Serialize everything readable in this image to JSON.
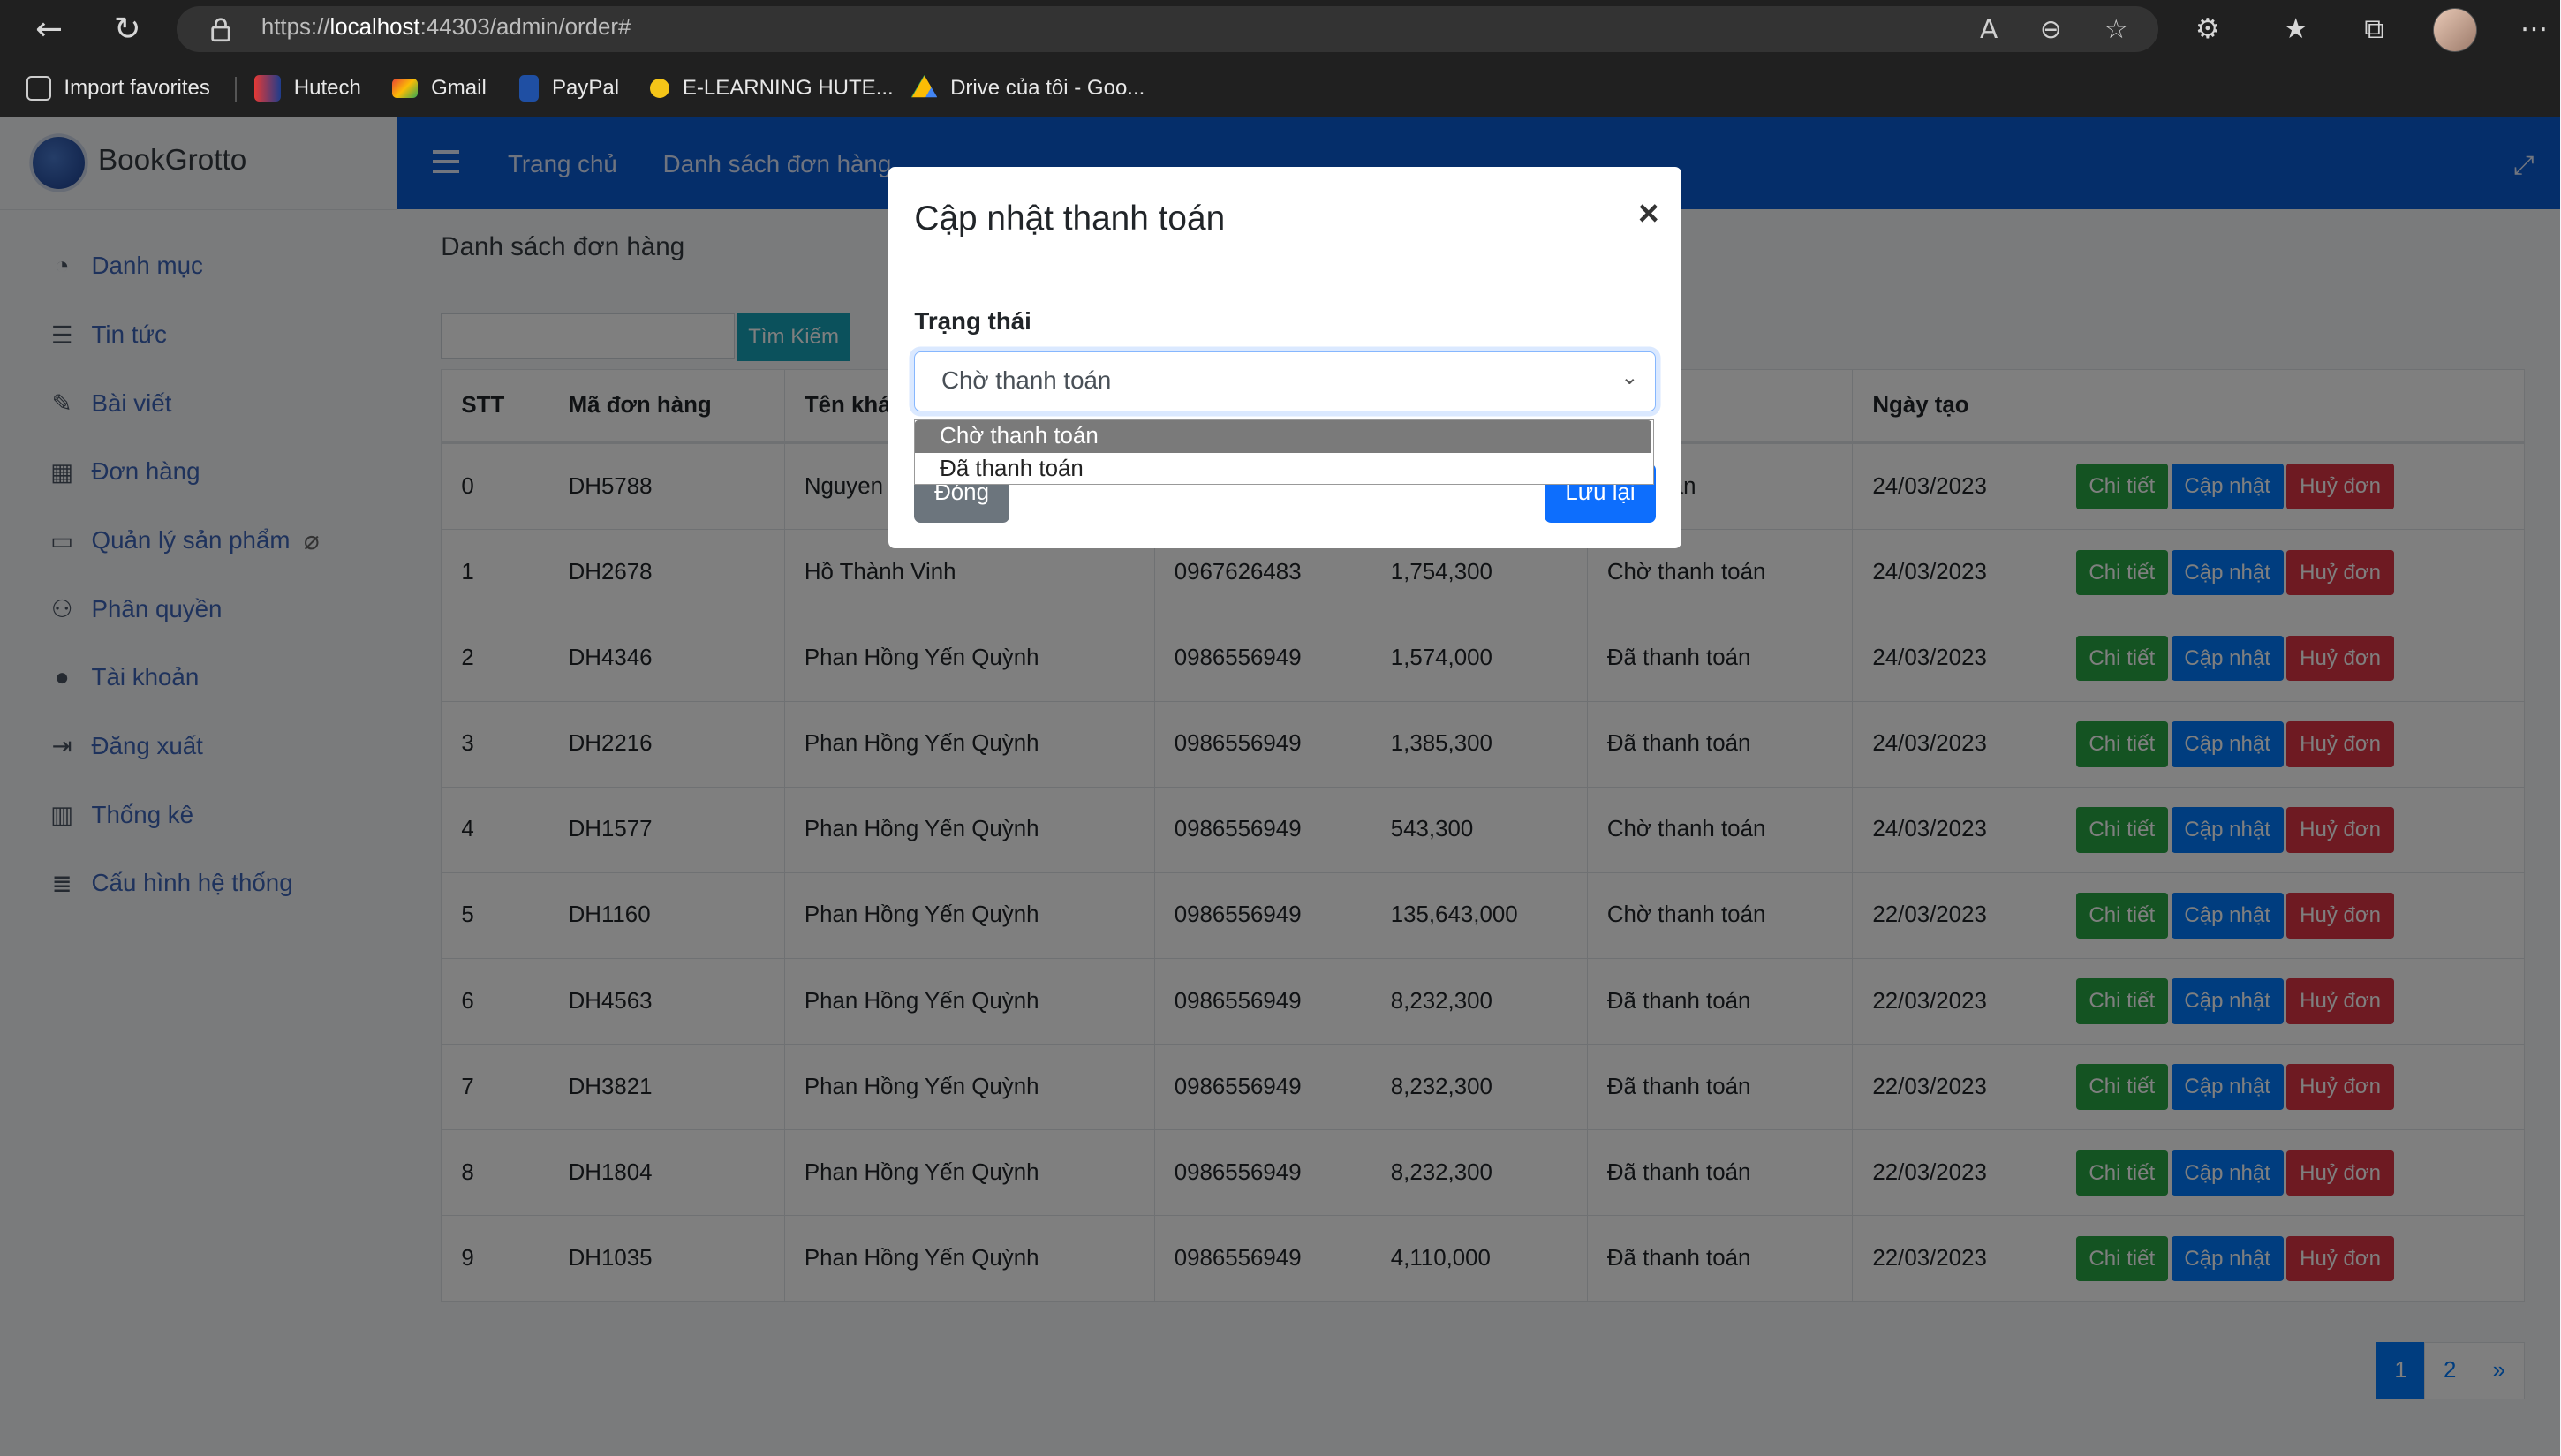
{
  "browser": {
    "url_prefix": "https://",
    "url_host": "localhost",
    "url_rest": ":44303/admin/order#",
    "bookmarks": [
      "Import favorites",
      "Hutech",
      "Gmail",
      "PayPal",
      "E-LEARNING HUTE...",
      "Drive của tôi - Goo..."
    ]
  },
  "brand": {
    "name": "BookGrotto"
  },
  "sidebar": {
    "items": [
      {
        "label": "Danh mục",
        "icon": "dashboard-icon"
      },
      {
        "label": "Tin tức",
        "icon": "list-icon"
      },
      {
        "label": "Bài viết",
        "icon": "brush-icon"
      },
      {
        "label": "Đơn hàng",
        "icon": "pallet-icon"
      },
      {
        "label": "Quản lý sản phẩm",
        "icon": "store-icon"
      },
      {
        "label": "Phân quyền",
        "icon": "users-icon"
      },
      {
        "label": "Tài khoản",
        "icon": "user-icon"
      },
      {
        "label": "Đăng xuất",
        "icon": "logout-icon"
      },
      {
        "label": "Thống kê",
        "icon": "chart-icon"
      },
      {
        "label": "Cấu hình hệ thống",
        "icon": "server-icon"
      }
    ]
  },
  "navbar": {
    "home": "Trang chủ",
    "orders": "Danh sách đơn hàng"
  },
  "content": {
    "title": "Danh sách đơn hàng",
    "search_button": "Tìm Kiếm",
    "columns": [
      "STT",
      "Mã đơn hàng",
      "Tên khá",
      "",
      "",
      "hái",
      "Ngày tạo",
      ""
    ],
    "rows": [
      {
        "stt": "0",
        "code": "DH5788",
        "name": "Nguyen",
        "phone": "",
        "total": "",
        "status": "anh toán",
        "date": "24/03/2023"
      },
      {
        "stt": "1",
        "code": "DH2678",
        "name": "Hồ Thành Vinh",
        "phone": "0967626483",
        "total": "1,754,300",
        "status": "Chờ thanh toán",
        "date": "24/03/2023"
      },
      {
        "stt": "2",
        "code": "DH4346",
        "name": "Phan Hồng Yến Quỳnh",
        "phone": "0986556949",
        "total": "1,574,000",
        "status": "Đã thanh toán",
        "date": "24/03/2023"
      },
      {
        "stt": "3",
        "code": "DH2216",
        "name": "Phan Hồng Yến Quỳnh",
        "phone": "0986556949",
        "total": "1,385,300",
        "status": "Đã thanh toán",
        "date": "24/03/2023"
      },
      {
        "stt": "4",
        "code": "DH1577",
        "name": "Phan Hồng Yến Quỳnh",
        "phone": "0986556949",
        "total": "543,300",
        "status": "Chờ thanh toán",
        "date": "24/03/2023"
      },
      {
        "stt": "5",
        "code": "DH1160",
        "name": "Phan Hồng Yến Quỳnh",
        "phone": "0986556949",
        "total": "135,643,000",
        "status": "Chờ thanh toán",
        "date": "22/03/2023"
      },
      {
        "stt": "6",
        "code": "DH4563",
        "name": "Phan Hồng Yến Quỳnh",
        "phone": "0986556949",
        "total": "8,232,300",
        "status": "Đã thanh toán",
        "date": "22/03/2023"
      },
      {
        "stt": "7",
        "code": "DH3821",
        "name": "Phan Hồng Yến Quỳnh",
        "phone": "0986556949",
        "total": "8,232,300",
        "status": "Đã thanh toán",
        "date": "22/03/2023"
      },
      {
        "stt": "8",
        "code": "DH1804",
        "name": "Phan Hồng Yến Quỳnh",
        "phone": "0986556949",
        "total": "8,232,300",
        "status": "Đã thanh toán",
        "date": "22/03/2023"
      },
      {
        "stt": "9",
        "code": "DH1035",
        "name": "Phan Hồng Yến Quỳnh",
        "phone": "0986556949",
        "total": "4,110,000",
        "status": "Đã thanh toán",
        "date": "22/03/2023"
      }
    ],
    "actions": {
      "detail": "Chi tiết",
      "update": "Cập nhật",
      "cancel": "Huỷ đơn"
    },
    "pagination": [
      "1",
      "2",
      "»"
    ]
  },
  "modal": {
    "title": "Cập nhật thanh toán",
    "close_symbol": "×",
    "label": "Trạng thái",
    "selected": "Chờ thanh toán",
    "options": [
      "Chờ thanh toán",
      "Đã thanh toán"
    ],
    "close_button": "Đóng",
    "save_button": "Lưu lại"
  },
  "colors": {
    "navbar": "#0b5cd5",
    "detail": "#28a745",
    "update": "#007bff",
    "cancel": "#dc3545",
    "search": "#17a2b8"
  }
}
